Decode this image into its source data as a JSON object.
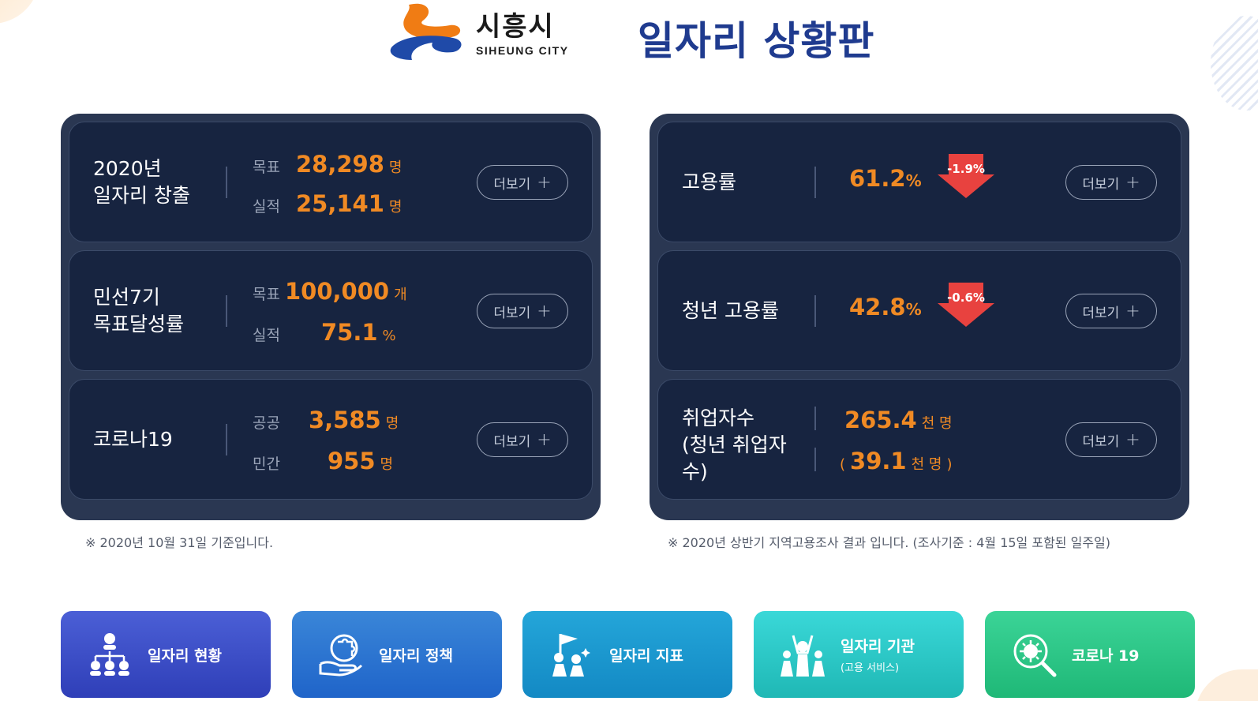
{
  "header": {
    "logo_ko": "시흥시",
    "logo_en": "SIHEUNG CITY",
    "title": "일자리 상황판"
  },
  "left_panel": {
    "cards": [
      {
        "title_lines": [
          "2020년",
          "일자리 창출"
        ],
        "rows": [
          {
            "label": "목표",
            "value": "28,298",
            "unit": "명"
          },
          {
            "label": "실적",
            "value": "25,141",
            "unit": "명"
          }
        ],
        "more": "더보기"
      },
      {
        "title_lines": [
          "민선7기",
          "목표달성률"
        ],
        "rows": [
          {
            "label": "목표",
            "value": "100,000",
            "unit": "개"
          },
          {
            "label": "실적",
            "value": "75.1",
            "unit": "%"
          }
        ],
        "more": "더보기"
      },
      {
        "title_lines": [
          "코로나19"
        ],
        "rows": [
          {
            "label": "공공",
            "value": "3,585",
            "unit": "명"
          },
          {
            "label": "민간",
            "value": "955",
            "unit": "명"
          }
        ],
        "more": "더보기"
      }
    ],
    "note": "※ 2020년 10월 31일 기준입니다."
  },
  "right_panel": {
    "cards": [
      {
        "title": "고용률",
        "value": "61.2",
        "unit": "%",
        "change": "-1.9%",
        "more": "더보기"
      },
      {
        "title": "청년 고용률",
        "value": "42.8",
        "unit": "%",
        "change": "-0.6%",
        "more": "더보기"
      },
      {
        "title_lines": [
          "취업자수",
          "(청년 취업자",
          "수)"
        ],
        "value": "265.4",
        "unit": "천 명",
        "sub_open": "(",
        "sub_value": "39.1",
        "sub_unit": "천 명",
        "sub_close": ")",
        "more": "더보기"
      }
    ],
    "note": "※ 2020년 상반기 지역고용조사 결과 입니다. (조사기준 : 4월 15일 포함된 일주일)"
  },
  "nav": [
    {
      "label": "일자리 현황",
      "icon": "organization-chart-icon",
      "color_from": "#4b5fd6",
      "color_to": "#2f3fb8"
    },
    {
      "label": "일자리 정책",
      "icon": "puzzle-hand-icon",
      "color_from": "#3a86d8",
      "color_to": "#1f64c9"
    },
    {
      "label": "일자리 지표",
      "icon": "flag-team-icon",
      "color_from": "#24a6d9",
      "color_to": "#1389c4"
    },
    {
      "label": "일자리 기관",
      "sub": "(고용 서비스)",
      "icon": "cheering-people-icon",
      "color_from": "#3ad8d8",
      "color_to": "#1fb8b5"
    },
    {
      "label": "코로나 19",
      "icon": "virus-magnifier-icon",
      "color_from": "#3bd497",
      "color_to": "#1fb877"
    }
  ]
}
